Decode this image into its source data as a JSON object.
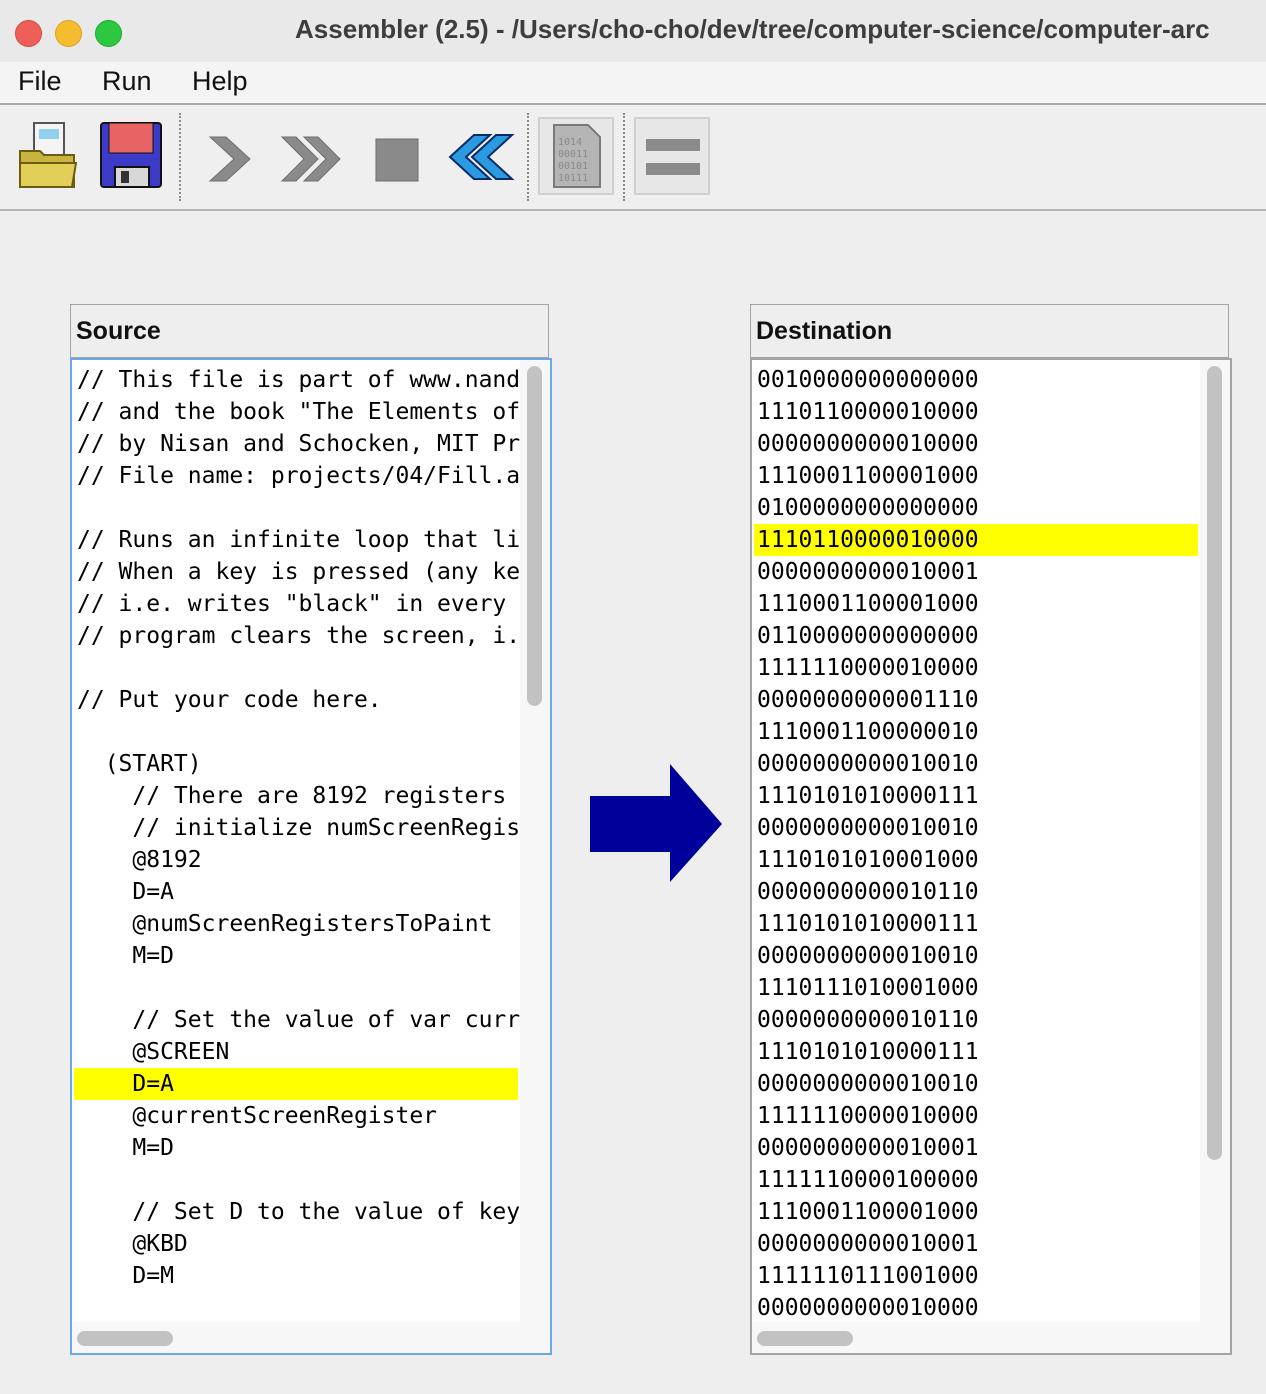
{
  "window": {
    "title": "Assembler (2.5) - /Users/cho-cho/dev/tree/computer-science/computer-arc"
  },
  "menu": {
    "file": "File",
    "run": "Run",
    "help": "Help"
  },
  "toolbar": {
    "icons": [
      "load-file-icon",
      "save-file-icon",
      "single-step-icon",
      "fast-forward-icon",
      "stop-icon",
      "rewind-icon",
      "translate-binary-icon",
      "compare-icon"
    ]
  },
  "source": {
    "header": "Source",
    "highlighted_index": 22,
    "lines": [
      "// This file is part of www.nand",
      "// and the book \"The Elements of",
      "// by Nisan and Schocken, MIT Pr",
      "// File name: projects/04/Fill.a",
      "",
      "// Runs an infinite loop that li",
      "// When a key is pressed (any ke",
      "// i.e. writes \"black\" in every",
      "// program clears the screen, i.",
      "",
      "// Put your code here.",
      "",
      "  (START)",
      "    // There are 8192 registers",
      "    // initialize numScreenRegis",
      "    @8192",
      "    D=A",
      "    @numScreenRegistersToPaint",
      "    M=D",
      "",
      "    // Set the value of var curr",
      "    @SCREEN",
      "    D=A",
      "    @currentScreenRegister",
      "    M=D",
      "",
      "    // Set D to the value of key",
      "    @KBD",
      "    D=M"
    ]
  },
  "destination": {
    "header": "Destination",
    "highlighted_index": 5,
    "lines": [
      "0010000000000000",
      "1110110000010000",
      "0000000000010000",
      "1110001100001000",
      "0100000000000000",
      "1110110000010000",
      "0000000000010001",
      "1110001100001000",
      "0110000000000000",
      "1111110000010000",
      "0000000000001110",
      "1110001100000010",
      "0000000000010010",
      "1110101010000111",
      "0000000000010010",
      "1110101010001000",
      "0000000000010110",
      "1110101010000111",
      "0000000000010010",
      "1110111010001000",
      "0000000000010110",
      "1110101010000111",
      "0000000000010010",
      "1111110000010000",
      "0000000000010001",
      "1111110000100000",
      "1110001100001000",
      "0000000000010001",
      "1111110111001000",
      "0000000000010000"
    ]
  },
  "colors": {
    "highlight": "#ffff00",
    "arrow": "#00009a"
  }
}
